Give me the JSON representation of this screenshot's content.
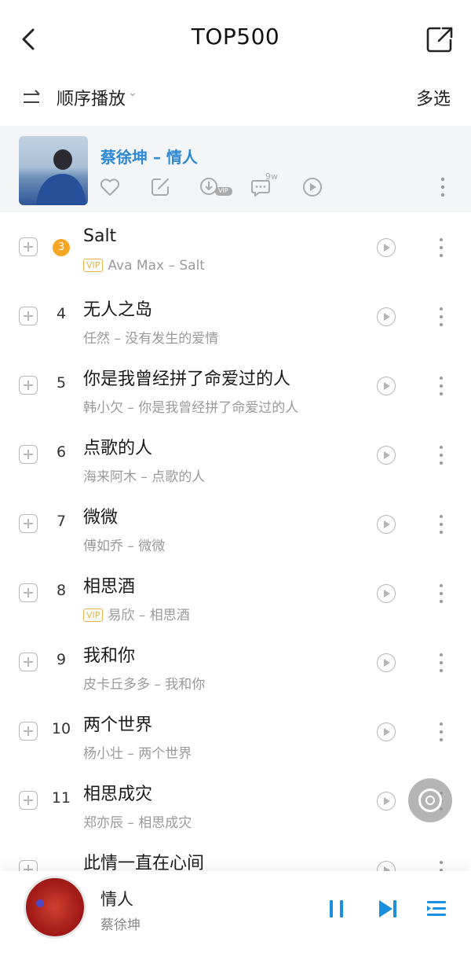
{
  "header": {
    "title": "TOP500",
    "back_icon": "chevron-left-icon",
    "share_icon": "share-icon"
  },
  "subbar": {
    "order_label": "顺序播放",
    "order_caret": "⌄",
    "multi_select": "多选"
  },
  "now_playing": {
    "title": "蔡徐坤 – 情人",
    "comment_count": "9w",
    "download_badge": "VIP",
    "accent": "#2f8ad6"
  },
  "songs": [
    {
      "rank": "3",
      "title": "Salt",
      "vip": true,
      "subtitle": "Ava Max – Salt",
      "highlight": true
    },
    {
      "rank": "4",
      "title": "无人之岛",
      "vip": false,
      "subtitle": "任然 – 没有发生的爱情"
    },
    {
      "rank": "5",
      "title": "你是我曾经拼了命爱过的人",
      "vip": false,
      "subtitle": "韩小欠 – 你是我曾经拼了命爱过的人"
    },
    {
      "rank": "6",
      "title": "点歌的人",
      "vip": false,
      "subtitle": "海来阿木 – 点歌的人"
    },
    {
      "rank": "7",
      "title": "微微",
      "vip": false,
      "subtitle": "傅如乔 – 微微"
    },
    {
      "rank": "8",
      "title": "相思酒",
      "vip": true,
      "subtitle": "易欣 – 相思酒"
    },
    {
      "rank": "9",
      "title": "我和你",
      "vip": false,
      "subtitle": "皮卡丘多多 – 我和你"
    },
    {
      "rank": "10",
      "title": "两个世界",
      "vip": false,
      "subtitle": "杨小壮 – 两个世界"
    },
    {
      "rank": "11",
      "title": "相思成灾",
      "vip": false,
      "subtitle": "郑亦辰 – 相思成灾"
    },
    {
      "rank": "",
      "title": "此情一直在心间",
      "vip": false,
      "subtitle": ""
    }
  ],
  "vip_label": "VIP",
  "mini_player": {
    "title": "情人",
    "artist": "蔡徐坤",
    "accent": "#1a8fe0"
  }
}
